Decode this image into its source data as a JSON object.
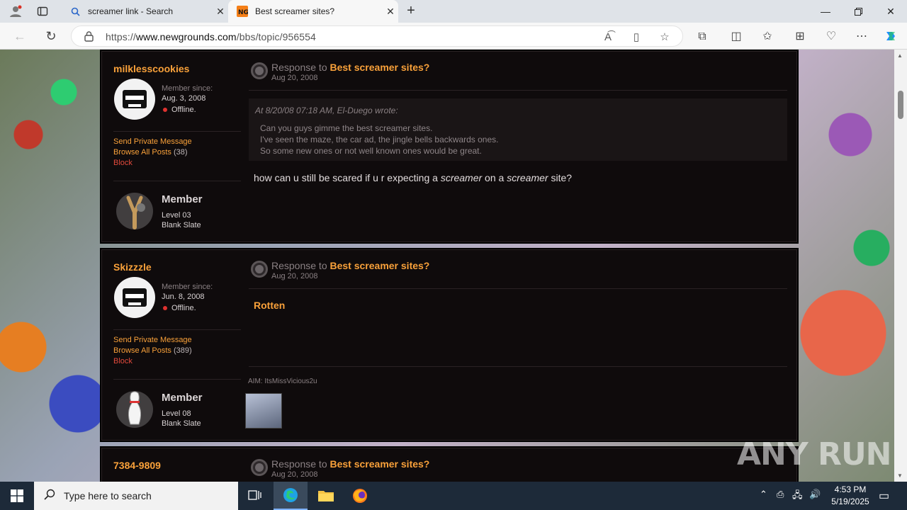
{
  "browser": {
    "tabs": [
      {
        "title": "screamer link - Search",
        "active": false
      },
      {
        "title": "Best screamer sites?",
        "active": true
      }
    ],
    "url_prefix": "https://",
    "url_domain": "www.newgrounds.com",
    "url_path": "/bbs/topic/956554"
  },
  "posts": [
    {
      "username": "milklesscookies",
      "member_since_label": "Member since:",
      "join_date": "Aug. 3, 2008",
      "status": "Offline.",
      "send_pm": "Send Private Message",
      "browse_posts": "Browse All Posts",
      "post_count": "(38)",
      "block": "Block",
      "rank": "Member",
      "level": "Level 03",
      "title": "Blank Slate",
      "response_prefix": "Response to",
      "topic": "Best screamer sites?",
      "date": "Aug 20, 2008",
      "quote_header": "At 8/20/08 07:18 AM, El-Duego wrote:",
      "quote_lines": [
        "Can you guys gimme the best screamer sites.",
        "I've seen the maze, the car ad, the jingle bells backwards ones.",
        "So some new ones or not well known ones would be great."
      ],
      "body_parts": [
        "how can u still be scared if u r expecting a ",
        "screamer",
        " on a ",
        "screamer",
        " site?"
      ]
    },
    {
      "username": "Skizzzle",
      "member_since_label": "Member since:",
      "join_date": "Jun. 8, 2008",
      "status": "Offline.",
      "send_pm": "Send Private Message",
      "browse_posts": "Browse All Posts",
      "post_count": "(389)",
      "block": "Block",
      "rank": "Member",
      "level": "Level 08",
      "title": "Blank Slate",
      "response_prefix": "Response to",
      "topic": "Best screamer sites?",
      "date": "Aug 20, 2008",
      "body": "Rotten",
      "signature": "AIM: ItsMissVicious2u"
    },
    {
      "username": "7384-9809",
      "response_prefix": "Response to",
      "topic": "Best screamer sites?",
      "date": "Aug 20, 2008"
    }
  ],
  "watermark": "ANY RUN",
  "taskbar": {
    "search_placeholder": "Type here to search",
    "time": "4:53 PM",
    "date": "5/19/2025"
  },
  "colors": {
    "accent_orange": "#f9a13a",
    "post_bg": "#0f0b0c",
    "offline_dot": "#e0322f"
  }
}
